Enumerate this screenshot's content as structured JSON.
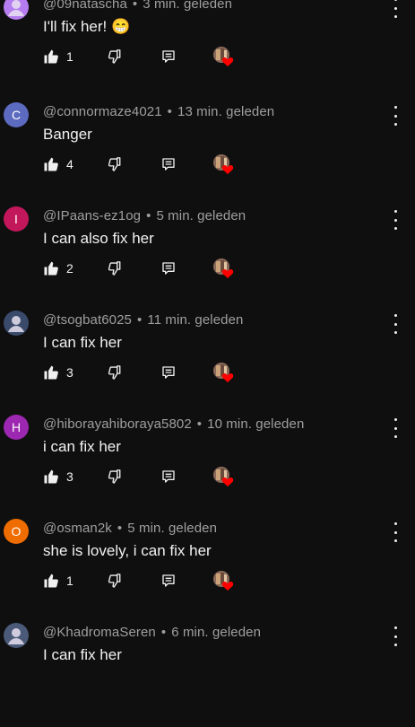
{
  "comments": [
    {
      "handle": "@09natascha",
      "time": "3 min. geleden",
      "text": "I'll fix her! 😁",
      "likes": "1",
      "avatar": {
        "type": "image",
        "letter": "",
        "color": "#b67df0"
      }
    },
    {
      "handle": "@connormaze4021",
      "time": "13 min. geleden",
      "text": "Banger",
      "likes": "4",
      "avatar": {
        "type": "letter",
        "letter": "C",
        "color": "#5c6bc0"
      }
    },
    {
      "handle": "@IPaans-ez1og",
      "time": "5 min. geleden",
      "text": "I can also fix her",
      "likes": "2",
      "avatar": {
        "type": "letter",
        "letter": "I",
        "color": "#c2185b"
      }
    },
    {
      "handle": "@tsogbat6025",
      "time": "11 min. geleden",
      "text": "I can fix her",
      "likes": "3",
      "avatar": {
        "type": "image",
        "letter": "",
        "color": "#3a4a6a"
      }
    },
    {
      "handle": "@hiborayahiboraya5802",
      "time": "10 min. geleden",
      "text": "i can fix her",
      "likes": "3",
      "avatar": {
        "type": "letter",
        "letter": "H",
        "color": "#9c27b0"
      }
    },
    {
      "handle": "@osman2k",
      "time": "5 min. geleden",
      "text": "she is lovely, i can fix her",
      "likes": "1",
      "avatar": {
        "type": "letter",
        "letter": "O",
        "color": "#ef6c00"
      }
    },
    {
      "handle": "@KhadromaSeren",
      "time": "6 min. geleden",
      "text": "I can fix her",
      "likes": "",
      "avatar": {
        "type": "image",
        "letter": "",
        "color": "#4a5a78"
      }
    }
  ],
  "icons": {
    "like": "thumbs-up-icon",
    "dislike": "thumbs-down-icon",
    "reply": "reply-icon",
    "more": "more-vert-icon",
    "creator_heart": "creator-heart-icon"
  }
}
